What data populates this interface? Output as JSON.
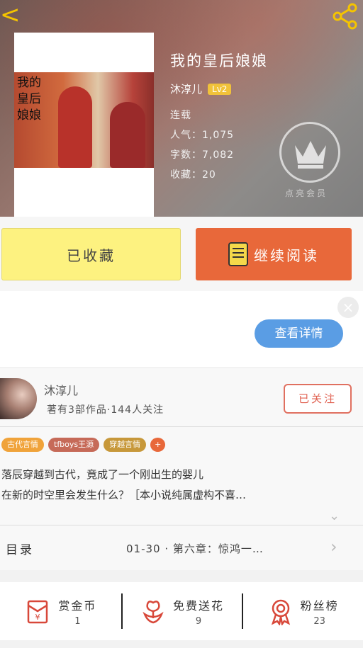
{
  "header": {
    "back_glyph": "<",
    "share_icon": "share-icon",
    "cover_title": "我的皇后娘娘",
    "title": "我的皇后娘娘",
    "author": "沐淳儿",
    "level": "Lv2",
    "status": "连载",
    "popularity": "人气：1,075",
    "word_count": "字数：7,082",
    "favorites": "收藏：20",
    "vip_badge_label": "点亮会员",
    "accent_color": "#f5c400"
  },
  "actions": {
    "favorite_label": "已收藏",
    "favorite_color": "#fdf280",
    "read_label": "继续阅读",
    "read_color": "#e8683a"
  },
  "ad": {
    "close_glyph": "×",
    "details_label": "查看详情"
  },
  "author_card": {
    "name": "沐淳儿",
    "stats": "著有3部作品·144人关注",
    "follow_label": "已关注",
    "tags": [
      "古代言情",
      "tfboys王源",
      "穿越言情",
      "+"
    ],
    "tag_colors": [
      "#f0a33a",
      "#c66a58",
      "#c7983a",
      "#e8683a"
    ],
    "description_line1": "落辰穿越到古代，竟成了一个刚出生的婴儿",
    "description_line2": "在新的时空里会发生什么？［本小说纯属虚构不喜…",
    "toc_label": "目录",
    "toc_latest": "01-30 · 第六章：惊鸿一…"
  },
  "bottom_stats": [
    {
      "label": "赏金币",
      "value": "1",
      "icon": "red-envelope-icon"
    },
    {
      "label": "免费送花",
      "value": "9",
      "icon": "flower-icon"
    },
    {
      "label": "粉丝榜",
      "value": "23",
      "icon": "medal-icon"
    }
  ]
}
